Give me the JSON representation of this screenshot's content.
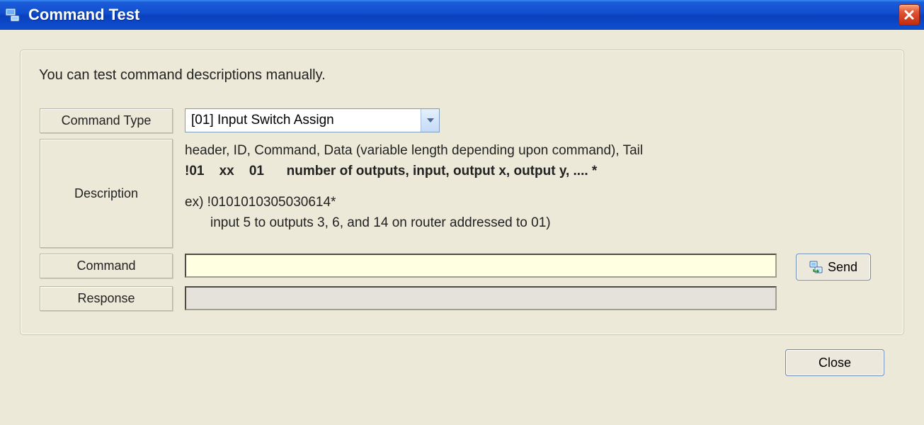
{
  "window": {
    "title": "Command Test"
  },
  "panel": {
    "intro": "You can test command descriptions manually.",
    "labels": {
      "command_type": "Command Type",
      "description": "Description",
      "command": "Command",
      "response": "Response"
    },
    "command_type_selected": "[01] Input Switch Assign",
    "description": {
      "line1": "header, ID, Command,  Data  (variable length depending upon command),   Tail",
      "line2": "!01    xx    01      number of outputs, input, output x, output y, .... *",
      "example": "ex) !0101010305030614*",
      "example_detail": "input 5 to outputs 3, 6, and 14 on router addressed to 01)"
    },
    "command_value": "",
    "response_value": ""
  },
  "buttons": {
    "send": "Send",
    "close": "Close"
  },
  "icons": {
    "app": "app-icon",
    "close_x": "close-icon",
    "send": "send-icon"
  }
}
